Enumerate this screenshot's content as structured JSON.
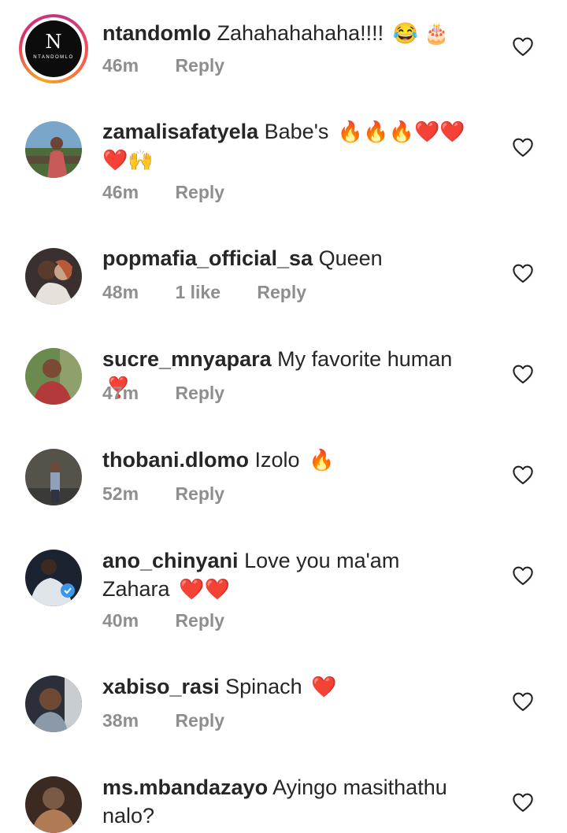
{
  "comments": [
    {
      "username": "ntandomlo",
      "text": "Zahahahahaha!!!!",
      "emoji": "😂 🎂",
      "time": "46m",
      "reply": "Reply",
      "avatar": {
        "monogram": "N",
        "brand": "NTANDOMLO",
        "colors": [
          "#0c0c0c",
          "#ffffff"
        ]
      }
    },
    {
      "username": "zamalisafatyela",
      "text": "Babe's",
      "emoji": "🔥🔥🔥❤️❤️ ❤️🙌",
      "time": "46m",
      "reply": "Reply",
      "avatar": {
        "colors": [
          "#7aa6c9",
          "#4d6b3a",
          "#c95a5a"
        ]
      }
    },
    {
      "username": "popmafia_official_sa",
      "text": "Queen",
      "emoji": "",
      "time": "48m",
      "likes": "1 like",
      "reply": "Reply",
      "avatar": {
        "colors": [
          "#3a3030",
          "#c7a58a",
          "#e7e1dc"
        ]
      }
    },
    {
      "username": "sucre_mnyapara",
      "text": "My favorite human",
      "emoji": "❣️",
      "time": "47m",
      "reply": "Reply",
      "avatar": {
        "colors": [
          "#6a8a4f",
          "#7a4a34",
          "#b23a3a"
        ]
      }
    },
    {
      "username": "thobani.dlomo",
      "text": "Izolo",
      "emoji": "🔥",
      "time": "52m",
      "reply": "Reply",
      "avatar": {
        "colors": [
          "#55524a",
          "#2f3442",
          "#8fa0b8"
        ]
      }
    },
    {
      "username": "ano_chinyani",
      "text": "Love you ma'am Zahara",
      "emoji": "❤️❤️",
      "time": "40m",
      "reply": "Reply",
      "avatar": {
        "colors": [
          "#1b2230",
          "#dfe5ea",
          "#3a97e8"
        ]
      }
    },
    {
      "username": "xabiso_rasi",
      "text": "Spinach",
      "emoji": "❤️",
      "time": "38m",
      "reply": "Reply",
      "avatar": {
        "colors": [
          "#2a2f3a",
          "#6e4a34",
          "#c8cdd2"
        ]
      }
    },
    {
      "username": "ms.mbandazayo",
      "text": "Ayingo masithathu nalo?",
      "emoji": "",
      "time": "",
      "reply": "",
      "avatar": {
        "colors": [
          "#3b2a22",
          "#7a5a44",
          "#b07a55"
        ]
      }
    }
  ],
  "icons": {
    "like": "heart-outline-icon"
  },
  "colors": {
    "text": "#262626",
    "meta": "#8e8e8e",
    "heart": "#262626"
  }
}
